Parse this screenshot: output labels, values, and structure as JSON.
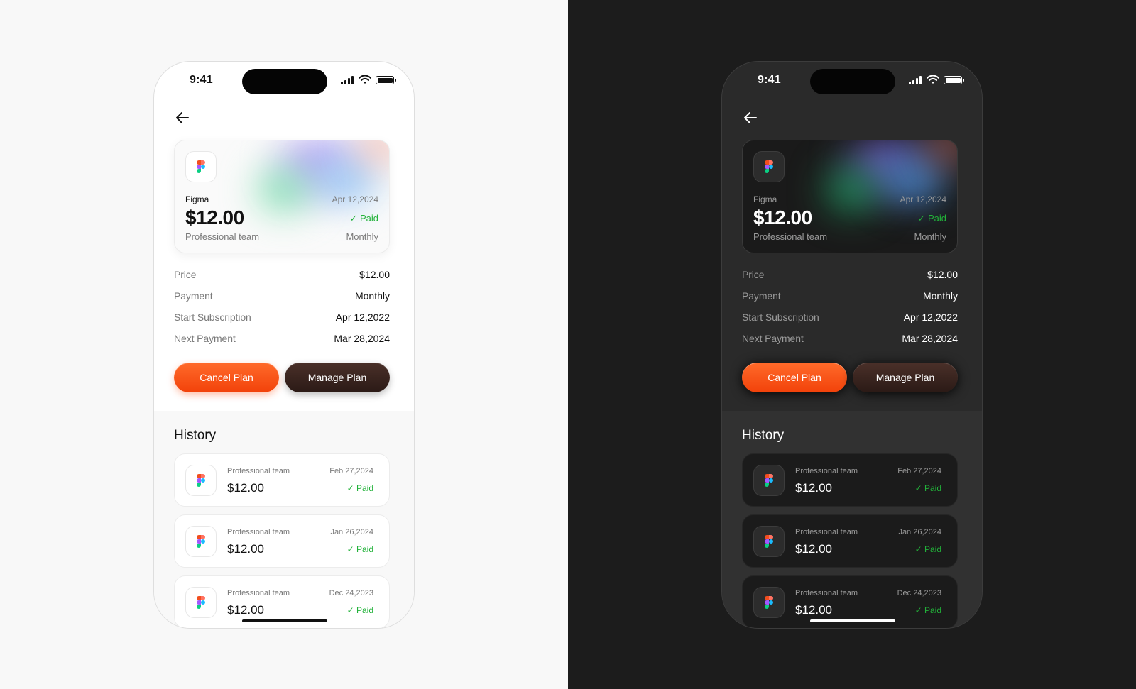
{
  "status": {
    "time": "9:41"
  },
  "card": {
    "app": "Figma",
    "date": "Apr 12,2024",
    "amount": "$12.00",
    "status": "Paid",
    "plan": "Professional team",
    "cycle": "Monthly"
  },
  "details": [
    {
      "label": "Price",
      "value": "$12.00"
    },
    {
      "label": "Payment",
      "value": "Monthly"
    },
    {
      "label": "Start Subscription",
      "value": "Apr 12,2022"
    },
    {
      "label": "Next Payment",
      "value": "Mar 28,2024"
    }
  ],
  "buttons": {
    "cancel": "Cancel Plan",
    "manage": "Manage Plan"
  },
  "history": {
    "title": "History",
    "items": [
      {
        "plan": "Professional team",
        "date": "Feb 27,2024",
        "amount": "$12.00",
        "status": "Paid"
      },
      {
        "plan": "Professional team",
        "date": "Jan 26,2024",
        "amount": "$12.00",
        "status": "Paid"
      },
      {
        "plan": "Professional team",
        "date": "Dec 24,2023",
        "amount": "$12.00",
        "status": "Paid"
      }
    ]
  },
  "colors": {
    "accent": "#ff5a1a",
    "manage_button": "#3a2520",
    "paid": "#22b23a",
    "light_bg": "#f8f8f8",
    "dark_bg": "#1c1c1c"
  },
  "icons": [
    "back-arrow-icon",
    "figma-logo-icon",
    "check-icon",
    "cellular-signal-icon",
    "wifi-icon",
    "battery-icon"
  ]
}
